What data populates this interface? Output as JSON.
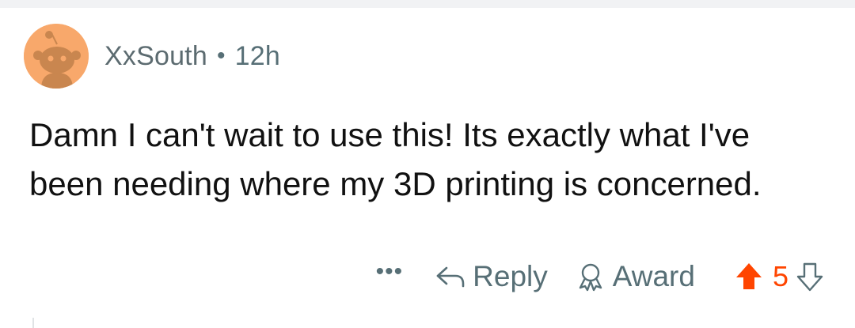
{
  "comment": {
    "username": "XxSouth",
    "separator": "•",
    "time_ago": "12h",
    "body": "Damn I can't wait to use this! Its exactly what I've been needing where my 3D printing is concerned.",
    "actions": {
      "more_label": "•••",
      "reply_label": "Reply",
      "award_label": "Award",
      "vote_count": "5",
      "upvoted": true
    }
  },
  "colors": {
    "upvote_active": "#ff4500",
    "avatar_bg": "#f8a86b",
    "meta_text": "#576f76",
    "body_text": "#111111"
  },
  "icons": {
    "avatar": "snoo-avatar-icon",
    "more": "more-options-icon",
    "reply": "reply-arrow-icon",
    "award": "award-ribbon-icon",
    "upvote": "upvote-arrow-icon",
    "downvote": "downvote-arrow-icon"
  }
}
